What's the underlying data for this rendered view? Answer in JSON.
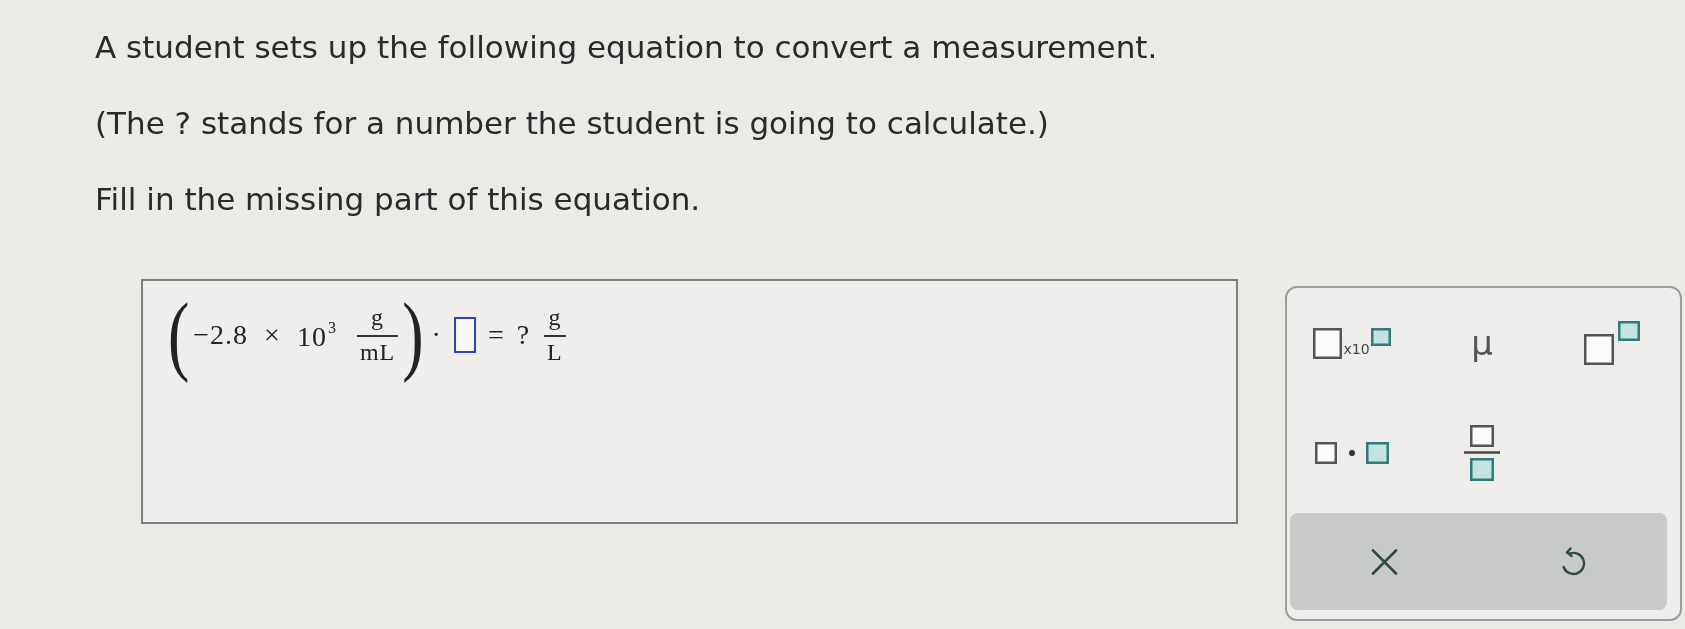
{
  "prompt": [
    "A student sets up the following equation to convert a measurement.",
    "(The ? stands for a number the student is going to calculate.)",
    "Fill in the missing part of this equation."
  ],
  "equation": {
    "open_paren": "(",
    "coefficient": "−2.8",
    "times": "×",
    "power": "10$^{3}$",
    "unit": {
      "numerator": "g",
      "denominator": "mL"
    },
    "close_paren": ")",
    "dot": "·",
    "answer_box": {
      "active": true
    },
    "equals": "=",
    "unknown": "?",
    "result_unit": {
      "numerator": "g",
      "denominator": "L"
    }
  },
  "toolbar": {
    "buttons": [
      {
        "kind": "scientific",
        "label": "x10"
      },
      {
        "kind": "symbol",
        "label": "μ"
      },
      {
        "kind": "superscript"
      },
      {
        "kind": "product"
      },
      {
        "kind": "fraction"
      }
    ],
    "actions": [
      {
        "kind": "clear"
      },
      {
        "kind": "undo"
      }
    ]
  }
}
